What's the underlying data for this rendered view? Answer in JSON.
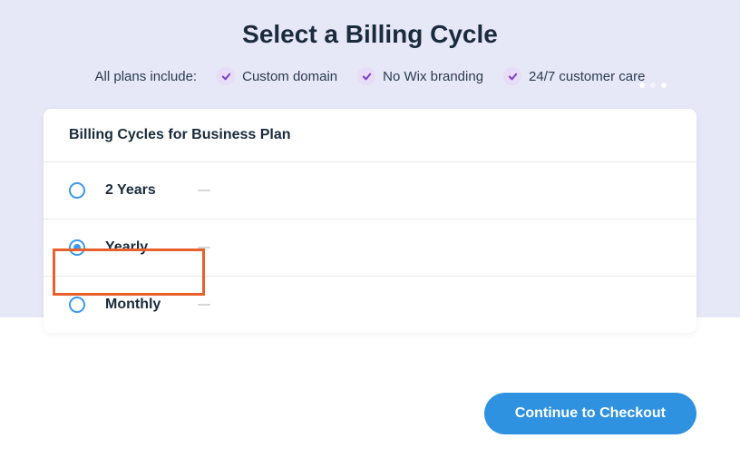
{
  "header": {
    "title": "Select a Billing Cycle",
    "features_label": "All plans include:",
    "features": [
      "Custom domain",
      "No Wix branding",
      "24/7 customer care"
    ]
  },
  "card": {
    "title": "Billing Cycles for Business Plan",
    "options": [
      {
        "label": "2 Years",
        "selected": false
      },
      {
        "label": "Yearly",
        "selected": true
      },
      {
        "label": "Monthly",
        "selected": false
      }
    ]
  },
  "actions": {
    "checkout_label": "Continue to Checkout"
  }
}
